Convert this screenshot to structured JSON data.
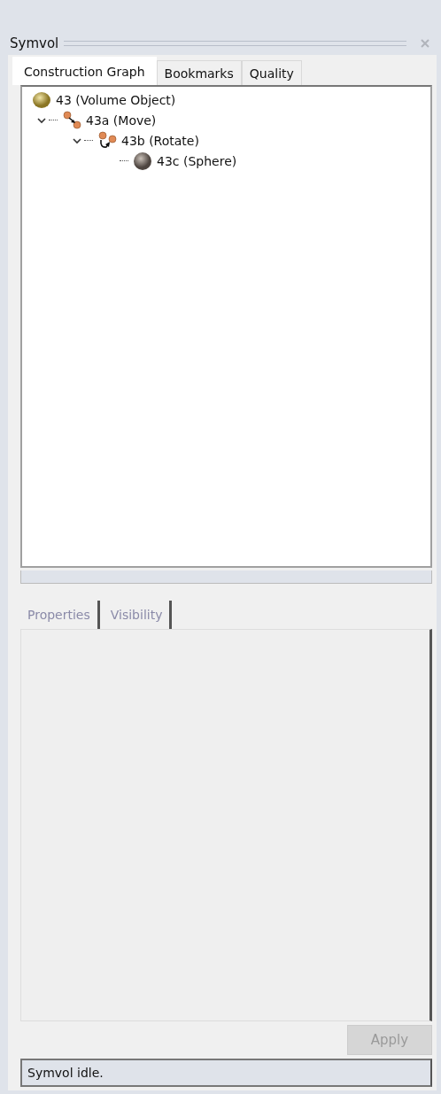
{
  "panel": {
    "title": "Symvol"
  },
  "tabs": [
    {
      "label": "Construction Graph",
      "selected": true
    },
    {
      "label": "Bookmarks",
      "selected": false
    },
    {
      "label": "Quality",
      "selected": false
    }
  ],
  "tree": [
    {
      "label": "43 (Volume Object)",
      "kind": "volume",
      "children": [
        {
          "label": "43a (Move)",
          "kind": "move",
          "expanded": true,
          "children": [
            {
              "label": "43b (Rotate)",
              "kind": "rotate",
              "expanded": true,
              "children": [
                {
                  "label": "43c (Sphere)",
                  "kind": "sphere"
                }
              ]
            }
          ]
        }
      ]
    }
  ],
  "bottom_tabs": [
    {
      "label": "Properties",
      "disabled": true
    },
    {
      "label": "Visibility",
      "disabled": true
    }
  ],
  "apply_button": {
    "label": "Apply",
    "disabled": true
  },
  "status_bar": "Symvol idle."
}
